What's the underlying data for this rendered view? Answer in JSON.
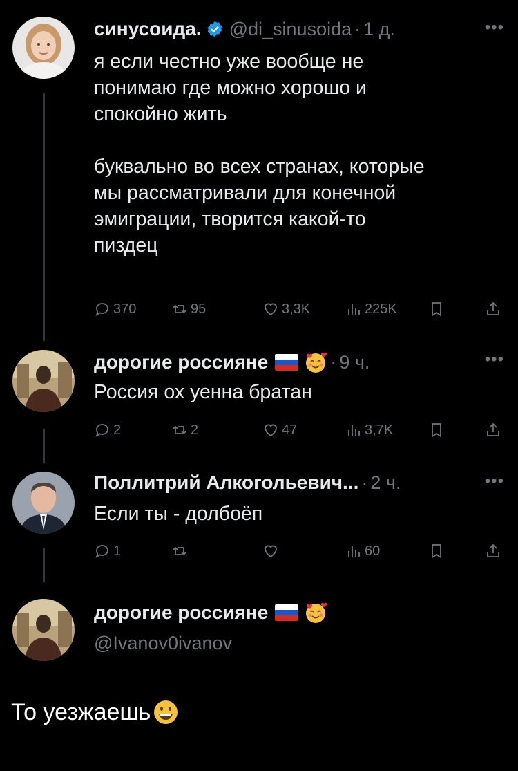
{
  "tweets": [
    {
      "name": "синусоида.",
      "handle": "@di_sinusoida",
      "time": "1 д.",
      "text": "я если честно уже вообще не\nпонимаю где можно хорошо и\nспокойно жить\n\nбуквально во всех странах, которые\nмы рассматривали для конечной\nэмиграции, творится какой-то\nпиздец",
      "replies": "370",
      "retweets": "95",
      "likes": "3,3K",
      "views": "225K"
    },
    {
      "name": "дорогие россияне",
      "time": "9 ч.",
      "text": "Россия ох уенна братан",
      "replies": "2",
      "retweets": "2",
      "likes": "47",
      "views": "3,7K"
    },
    {
      "name": "Поллитрий Алкогольевич...",
      "time": "2 ч.",
      "text": "Если ты - долбоёп",
      "replies": "1",
      "retweets": "",
      "likes": "",
      "views": "60"
    },
    {
      "name": "дорогие россияне",
      "handle": "@Ivanov0ivanov"
    }
  ],
  "caption": "То уезжаешь",
  "colors": {
    "background": "#000000",
    "text": "#e7e9ea",
    "muted": "#71767b",
    "verified": "#1d9bf0",
    "thread_line": "#333639"
  },
  "icons": [
    "reply-icon",
    "retweet-icon",
    "like-icon",
    "views-icon",
    "bookmark-icon",
    "share-icon",
    "verified-icon",
    "more-icon"
  ]
}
